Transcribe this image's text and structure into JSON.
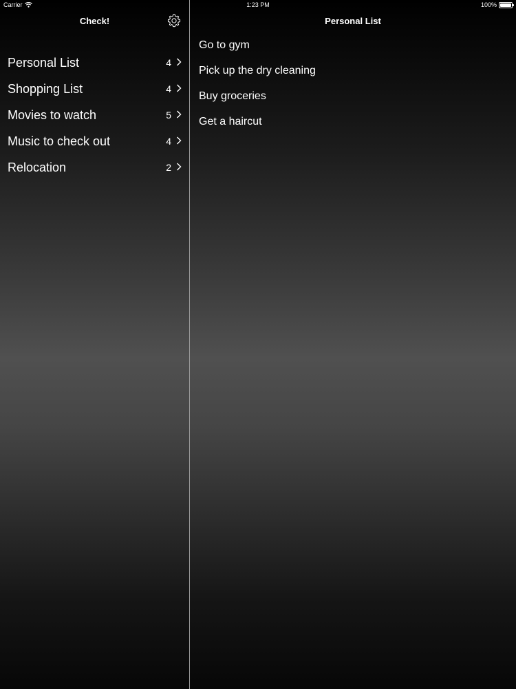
{
  "status_bar": {
    "carrier": "Carrier",
    "time": "1:23 PM",
    "battery": "100%"
  },
  "master": {
    "title": "Check!",
    "settings_icon": "gear-icon",
    "lists": [
      {
        "label": "Personal List",
        "count": "4"
      },
      {
        "label": "Shopping List",
        "count": "4"
      },
      {
        "label": "Movies to watch",
        "count": "5"
      },
      {
        "label": "Music to check out",
        "count": "4"
      },
      {
        "label": "Relocation",
        "count": "2"
      }
    ]
  },
  "detail": {
    "title": "Personal List",
    "items": [
      "Go to gym",
      "Pick up the dry cleaning",
      "Buy groceries",
      "Get a haircut"
    ]
  }
}
